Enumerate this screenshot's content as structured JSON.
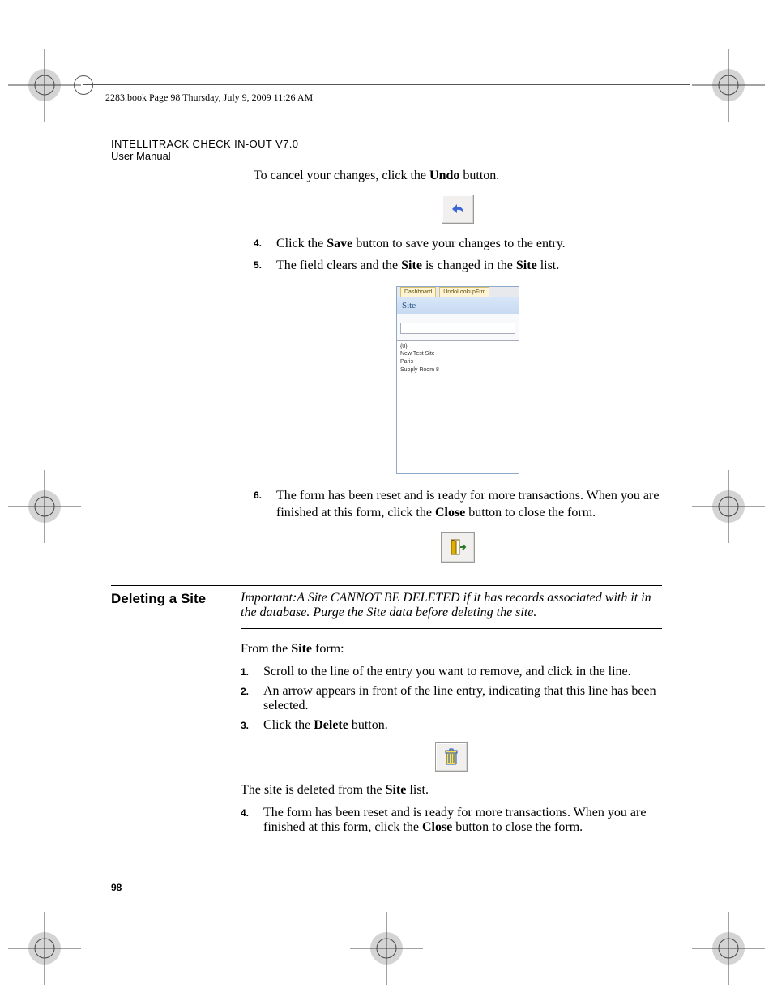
{
  "header": {
    "book_line": "2283.book  Page 98  Thursday, July 9, 2009  11:26 AM"
  },
  "doc": {
    "title_line": "INTELLITRACK CHECK IN-OUT V7.0",
    "subtitle": "User Manual"
  },
  "body": {
    "intro_prefix": "To cancel your changes, click the ",
    "intro_bold": "Undo",
    "intro_suffix": " button.",
    "step4": {
      "num": "4.",
      "pre": "Click the ",
      "b1": "Save",
      "post": " button to save your changes to the entry."
    },
    "step5": {
      "num": "5.",
      "pre": "The field clears and the ",
      "b1": "Site",
      "mid": " is changed in the ",
      "b2": "Site",
      "post": " list."
    },
    "screenshot": {
      "tab1": "Dashboard",
      "tab2": "UndoLookupFrm",
      "title": "Site",
      "rows": [
        "{0}",
        "New Test Site",
        "Paris",
        "Supply Room 8"
      ]
    },
    "step6": {
      "num": "6.",
      "pre": "The form has been reset and is ready for more transactions. When you are finished at this form, click the ",
      "b1": "Close",
      "post": " button to close the form."
    }
  },
  "section2": {
    "heading": "Deleting a Site",
    "note": "Important:A Site CANNOT BE DELETED if it has records associated with it in the database. Purge the Site data before deleting the site.",
    "lead_pre": "From the ",
    "lead_b": "Site",
    "lead_post": " form:",
    "s1": {
      "num": "1.",
      "text": "Scroll to the line of the entry you want to remove, and click in the line."
    },
    "s2": {
      "num": "2.",
      "text": "An arrow appears in front of the line entry, indicating that this line has been selected."
    },
    "s3": {
      "num": "3.",
      "pre": "Click the ",
      "b1": "Delete",
      "post": " button."
    },
    "after_delete_pre": "The site is deleted from the ",
    "after_delete_b": "Site",
    "after_delete_post": " list.",
    "s4": {
      "num": "4.",
      "pre": "The form has been reset and is ready for more transactions. When you are finished at this form, click the ",
      "b1": "Close",
      "post": " button to close the form."
    }
  },
  "page_number": "98"
}
